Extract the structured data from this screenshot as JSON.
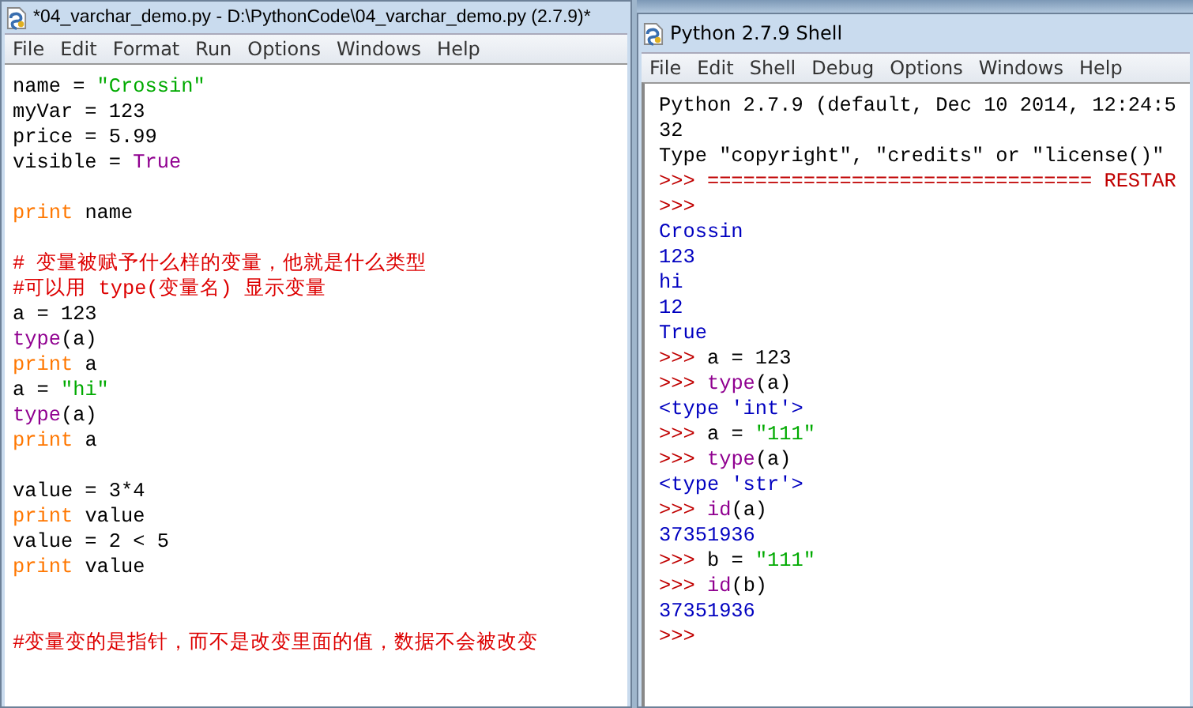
{
  "editor": {
    "title": "*04_varchar_demo.py - D:\\PythonCode\\04_varchar_demo.py (2.7.9)*",
    "menu": [
      "File",
      "Edit",
      "Format",
      "Run",
      "Options",
      "Windows",
      "Help"
    ],
    "lines": [
      {
        "kind": "code",
        "segments": [
          {
            "kind": "plain",
            "text": "name = "
          },
          {
            "kind": "string",
            "text": "\"Crossin\""
          }
        ]
      },
      {
        "kind": "code",
        "segments": [
          {
            "kind": "plain",
            "text": "myVar = 123"
          }
        ]
      },
      {
        "kind": "code",
        "segments": [
          {
            "kind": "plain",
            "text": "price = 5.99"
          }
        ]
      },
      {
        "kind": "code",
        "segments": [
          {
            "kind": "plain",
            "text": "visible = "
          },
          {
            "kind": "builtin",
            "text": "True"
          }
        ]
      },
      {
        "kind": "blank"
      },
      {
        "kind": "code",
        "segments": [
          {
            "kind": "keyword",
            "text": "print"
          },
          {
            "kind": "plain",
            "text": " name"
          }
        ]
      },
      {
        "kind": "blank"
      },
      {
        "kind": "code",
        "segments": [
          {
            "kind": "comment",
            "text": "# 变量被赋予什么样的变量，他就是什么类型"
          }
        ]
      },
      {
        "kind": "code",
        "segments": [
          {
            "kind": "comment",
            "text": "#可以用 type(变量名) 显示变量"
          }
        ]
      },
      {
        "kind": "code",
        "segments": [
          {
            "kind": "plain",
            "text": "a = 123"
          }
        ]
      },
      {
        "kind": "code",
        "segments": [
          {
            "kind": "builtin",
            "text": "type"
          },
          {
            "kind": "plain",
            "text": "(a)"
          }
        ]
      },
      {
        "kind": "code",
        "segments": [
          {
            "kind": "keyword",
            "text": "print"
          },
          {
            "kind": "plain",
            "text": " a"
          }
        ]
      },
      {
        "kind": "code",
        "segments": [
          {
            "kind": "plain",
            "text": "a = "
          },
          {
            "kind": "string",
            "text": "\"hi\""
          }
        ]
      },
      {
        "kind": "code",
        "segments": [
          {
            "kind": "builtin",
            "text": "type"
          },
          {
            "kind": "plain",
            "text": "(a)"
          }
        ]
      },
      {
        "kind": "code",
        "segments": [
          {
            "kind": "keyword",
            "text": "print"
          },
          {
            "kind": "plain",
            "text": " a"
          }
        ]
      },
      {
        "kind": "blank"
      },
      {
        "kind": "code",
        "segments": [
          {
            "kind": "plain",
            "text": "value = 3*4"
          }
        ]
      },
      {
        "kind": "code",
        "segments": [
          {
            "kind": "keyword",
            "text": "print"
          },
          {
            "kind": "plain",
            "text": " value"
          }
        ]
      },
      {
        "kind": "code",
        "segments": [
          {
            "kind": "plain",
            "text": "value = 2 < 5"
          }
        ]
      },
      {
        "kind": "code",
        "segments": [
          {
            "kind": "keyword",
            "text": "print"
          },
          {
            "kind": "plain",
            "text": " value"
          }
        ]
      },
      {
        "kind": "blank"
      },
      {
        "kind": "blank"
      },
      {
        "kind": "code",
        "segments": [
          {
            "kind": "comment",
            "text": "#变量变的是指针，而不是改变里面的值，数据不会被改变"
          }
        ]
      }
    ]
  },
  "shell": {
    "title": "Python 2.7.9 Shell",
    "menu": [
      "File",
      "Edit",
      "Shell",
      "Debug",
      "Options",
      "Windows",
      "Help"
    ],
    "lines": [
      {
        "kind": "code",
        "segments": [
          {
            "kind": "plain",
            "text": "Python 2.7.9 (default, Dec 10 2014, 12:24:5"
          }
        ]
      },
      {
        "kind": "code",
        "segments": [
          {
            "kind": "plain",
            "text": "32"
          }
        ]
      },
      {
        "kind": "code",
        "segments": [
          {
            "kind": "plain",
            "text": "Type \"copyright\", \"credits\" or \"license()\""
          }
        ]
      },
      {
        "kind": "code",
        "segments": [
          {
            "kind": "prompt",
            "text": ">>> ================================ RESTAR"
          }
        ]
      },
      {
        "kind": "code",
        "segments": [
          {
            "kind": "prompt",
            "text": ">>>"
          }
        ]
      },
      {
        "kind": "code",
        "segments": [
          {
            "kind": "output",
            "text": "Crossin"
          }
        ]
      },
      {
        "kind": "code",
        "segments": [
          {
            "kind": "output",
            "text": "123"
          }
        ]
      },
      {
        "kind": "code",
        "segments": [
          {
            "kind": "output",
            "text": "hi"
          }
        ]
      },
      {
        "kind": "code",
        "segments": [
          {
            "kind": "output",
            "text": "12"
          }
        ]
      },
      {
        "kind": "code",
        "segments": [
          {
            "kind": "output",
            "text": "True"
          }
        ]
      },
      {
        "kind": "code",
        "segments": [
          {
            "kind": "prompt",
            "text": ">>> "
          },
          {
            "kind": "plain",
            "text": "a = 123"
          }
        ]
      },
      {
        "kind": "code",
        "segments": [
          {
            "kind": "prompt",
            "text": ">>> "
          },
          {
            "kind": "builtin",
            "text": "type"
          },
          {
            "kind": "plain",
            "text": "(a)"
          }
        ]
      },
      {
        "kind": "code",
        "segments": [
          {
            "kind": "output",
            "text": "<type 'int'>"
          }
        ]
      },
      {
        "kind": "code",
        "segments": [
          {
            "kind": "prompt",
            "text": ">>> "
          },
          {
            "kind": "plain",
            "text": "a = "
          },
          {
            "kind": "string",
            "text": "\"111\""
          }
        ]
      },
      {
        "kind": "code",
        "segments": [
          {
            "kind": "prompt",
            "text": ">>> "
          },
          {
            "kind": "builtin",
            "text": "type"
          },
          {
            "kind": "plain",
            "text": "(a)"
          }
        ]
      },
      {
        "kind": "code",
        "segments": [
          {
            "kind": "output",
            "text": "<type 'str'>"
          }
        ]
      },
      {
        "kind": "code",
        "segments": [
          {
            "kind": "prompt",
            "text": ">>> "
          },
          {
            "kind": "builtin",
            "text": "id"
          },
          {
            "kind": "plain",
            "text": "(a)"
          }
        ]
      },
      {
        "kind": "code",
        "segments": [
          {
            "kind": "output",
            "text": "37351936"
          }
        ]
      },
      {
        "kind": "code",
        "segments": [
          {
            "kind": "prompt",
            "text": ">>> "
          },
          {
            "kind": "plain",
            "text": "b = "
          },
          {
            "kind": "string",
            "text": "\"111\""
          }
        ]
      },
      {
        "kind": "code",
        "segments": [
          {
            "kind": "prompt",
            "text": ">>> "
          },
          {
            "kind": "builtin",
            "text": "id"
          },
          {
            "kind": "plain",
            "text": "(b)"
          }
        ]
      },
      {
        "kind": "code",
        "segments": [
          {
            "kind": "output",
            "text": "37351936"
          }
        ]
      },
      {
        "kind": "code",
        "segments": [
          {
            "kind": "prompt",
            "text": ">>>"
          }
        ]
      }
    ]
  }
}
